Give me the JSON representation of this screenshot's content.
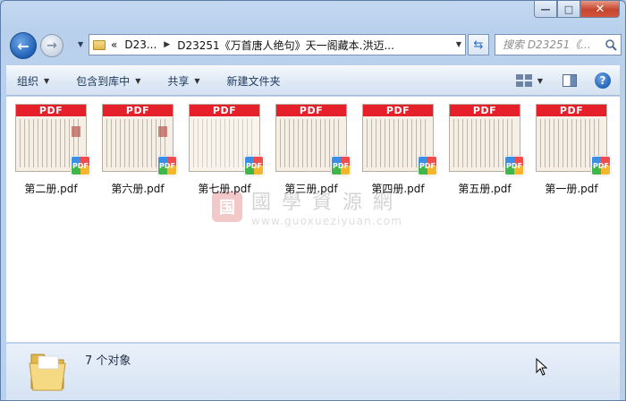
{
  "window": {
    "controls": {
      "minimize": "—",
      "maximize": "□",
      "close": "✕"
    }
  },
  "address": {
    "crumb_1": "D23...",
    "crumb_2": "D23251《万首唐人绝句》天一阁藏本.洪迈...",
    "chevrons": "«"
  },
  "search": {
    "placeholder": "搜索 D23251《..."
  },
  "toolbar": {
    "organize": "组织",
    "include_library": "包含到库中",
    "share": "共享",
    "new_folder": "新建文件夹",
    "help": "?"
  },
  "files": [
    {
      "name": "第二册.pdf",
      "banner": "PDF",
      "badge": "PDF"
    },
    {
      "name": "第六册.pdf",
      "banner": "PDF",
      "badge": "PDF"
    },
    {
      "name": "第七册.pdf",
      "banner": "PDF",
      "badge": "PDF"
    },
    {
      "name": "第三册.pdf",
      "banner": "PDF",
      "badge": "PDF"
    },
    {
      "name": "第四册.pdf",
      "banner": "PDF",
      "badge": "PDF"
    },
    {
      "name": "第五册.pdf",
      "banner": "PDF",
      "badge": "PDF"
    },
    {
      "name": "第一册.pdf",
      "banner": "PDF",
      "badge": "PDF"
    }
  ],
  "watermark": {
    "seal": "国",
    "title": "國學資源網",
    "url": "www.guoxueziyuan.com"
  },
  "status": {
    "count_text": "7 个对象"
  },
  "colors": {
    "pdf_banner": "#e5202a",
    "titlebar": "#c4d9f1",
    "accent_blue": "#1f5fb5"
  }
}
